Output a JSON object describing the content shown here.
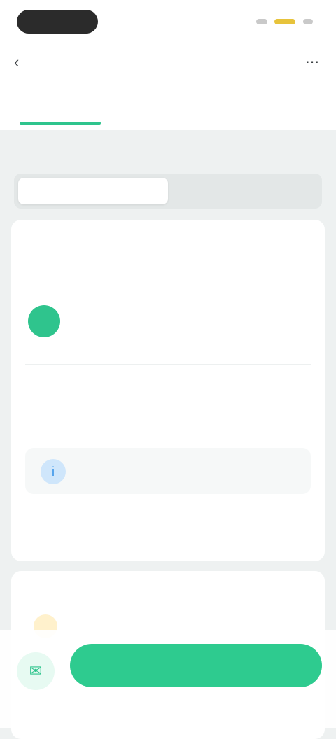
{
  "status_bar": {
    "colors": [
      "#c9c9c9",
      "#e7c33b",
      "#c9c9c9"
    ]
  },
  "nav": {
    "back_icon": "chevron-left-icon",
    "title": "",
    "menu_icon": "more-icon"
  },
  "tabs": [
    {
      "label": "",
      "active": true
    },
    {
      "label": ""
    },
    {
      "label": ""
    },
    {
      "label": ""
    }
  ],
  "section": {
    "title": "",
    "segments": [
      {
        "label": "",
        "active": true
      },
      {
        "label": ""
      }
    ]
  },
  "card": {
    "heading": "",
    "badge": "",
    "contact": {
      "label": "",
      "value": ""
    },
    "description_label": "",
    "description": "",
    "info": {
      "icon": "info-icon",
      "title": "",
      "subtitle": ""
    },
    "link": ""
  },
  "card2": {
    "heading": "",
    "item_text": ""
  },
  "bottom": {
    "icon": "chat-icon",
    "cta_label": ""
  },
  "colors": {
    "accent": "#2fc48d",
    "cta": "#2ecb8f",
    "background": "#eef1f1"
  }
}
